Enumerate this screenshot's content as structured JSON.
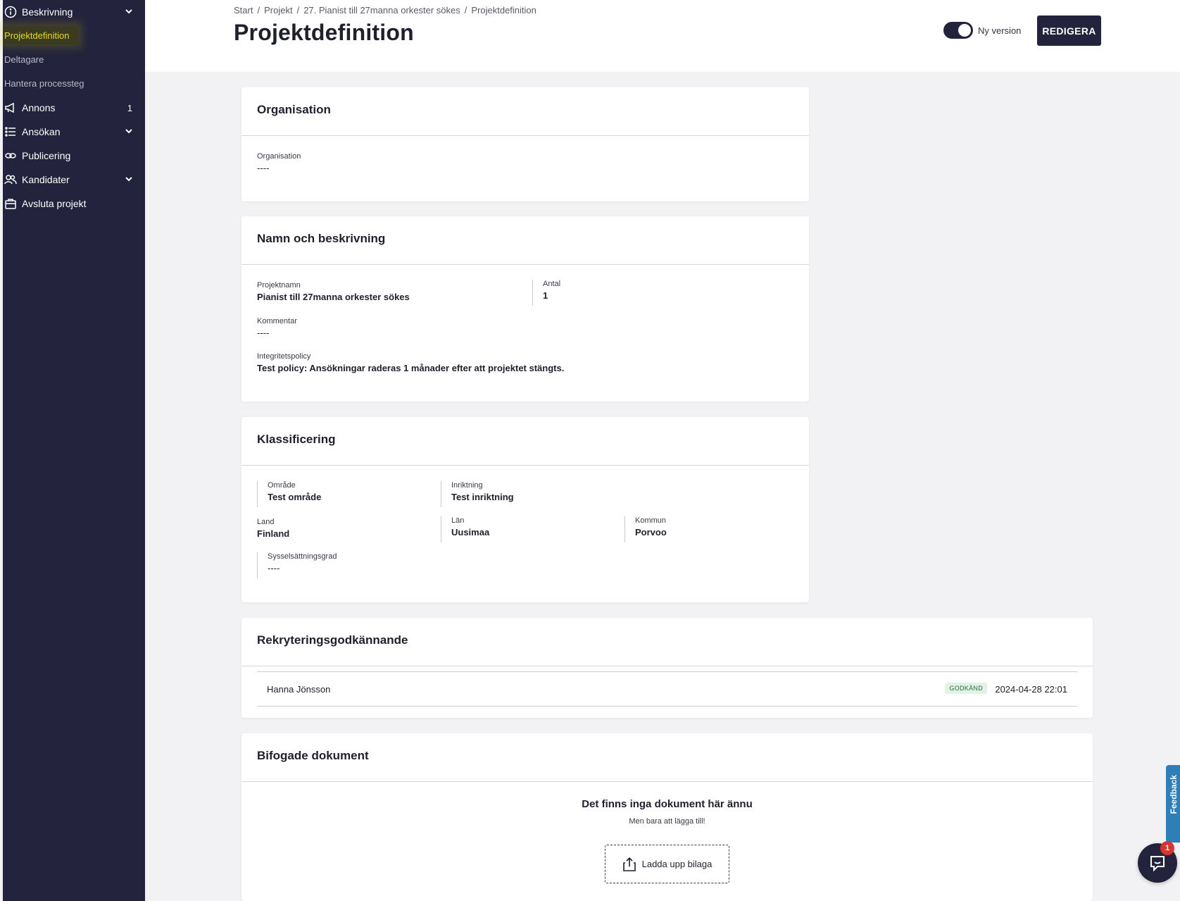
{
  "sidebar": {
    "items": [
      {
        "label": "Beskrivning",
        "icon": "info-icon",
        "has_chevron": true
      },
      {
        "label": "Annons",
        "icon": "megaphone-icon",
        "count": "1"
      },
      {
        "label": "Ansökan",
        "icon": "list-icon",
        "has_chevron": true
      },
      {
        "label": "Publicering",
        "icon": "link-icon"
      },
      {
        "label": "Kandidater",
        "icon": "users-icon",
        "has_chevron": true
      },
      {
        "label": "Avsluta projekt",
        "icon": "briefcase-icon"
      }
    ],
    "sub_items": [
      {
        "label": "Projektdefinition",
        "active": true
      },
      {
        "label": "Deltagare"
      },
      {
        "label": "Hantera processteg"
      }
    ]
  },
  "header": {
    "breadcrumb": [
      "Start",
      "Projekt",
      "27. Pianist till 27manna orkester sökes",
      "Projektdefinition"
    ],
    "breadcrumb_sep": "/",
    "title": "Projektdefinition",
    "toggle_label": "Ny version",
    "edit_button": "REDIGERA"
  },
  "organisation_card": {
    "title": "Organisation",
    "fields": [
      {
        "label": "Organisation",
        "value": "----"
      }
    ]
  },
  "name_card": {
    "title": "Namn och beskrivning",
    "project_name": {
      "label": "Projektnamn",
      "value": "Pianist till 27manna orkester sökes"
    },
    "count": {
      "label": "Antal",
      "value": "1"
    },
    "comment": {
      "label": "Kommentar",
      "value": "----"
    },
    "privacy": {
      "label": "Integritetspolicy",
      "value": "Test policy: Ansökningar raderas 1 månader efter att projektet stängts."
    }
  },
  "classification_card": {
    "title": "Klassificering",
    "area": {
      "label": "Område",
      "value": "Test område"
    },
    "direction": {
      "label": "Inriktning",
      "value": "Test inriktning"
    },
    "country": {
      "label": "Land",
      "value": "Finland"
    },
    "region": {
      "label": "Län",
      "value": "Uusimaa"
    },
    "municipality": {
      "label": "Kommun",
      "value": "Porvoo"
    },
    "employment": {
      "label": "Sysselsättningsgrad",
      "value": "----"
    }
  },
  "approval_card": {
    "title": "Rekryteringsgodkännande",
    "rows": [
      {
        "name": "Hanna Jönsson",
        "status": "GODKÄND",
        "date": "2024-04-28 22:01"
      }
    ],
    "status_color": "#e1f3e6"
  },
  "documents_card": {
    "title": "Bifogade dokument",
    "empty_title": "Det finns inga dokument här ännu",
    "empty_sub": "Men bara att lägga till!",
    "upload_label": "Ladda upp bilaga"
  },
  "feedback_tab": {
    "label": "Feedback"
  },
  "chat": {
    "badge": "1"
  },
  "colors": {
    "sidebar_bg": "#23233d",
    "active_highlight": "#e6d72a",
    "primary": "#23233d",
    "feedback": "#2e7fb8"
  }
}
